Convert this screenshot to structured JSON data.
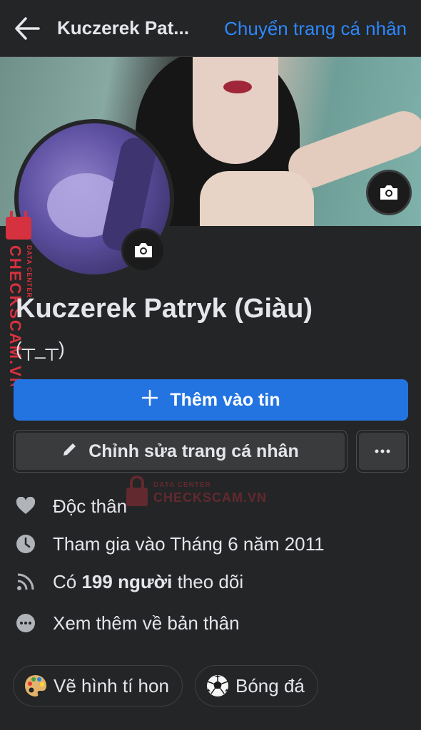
{
  "header": {
    "profile_title": "Kuczerek Pat...",
    "switch_link": "Chuyển trang cá nhân"
  },
  "profile": {
    "name": "Kuczerek Patryk (Giàu)",
    "bio": "(┬_┬)"
  },
  "actions": {
    "add_story": "Thêm vào tin",
    "edit_profile": "Chỉnh sửa trang cá nhân"
  },
  "details": {
    "relationship": "Độc thân",
    "joined": "Tham gia vào Tháng 6 năm 2011",
    "followers_prefix": "Có ",
    "followers_count": "199 người",
    "followers_suffix": " theo dõi",
    "see_more": "Xem thêm về bản thân"
  },
  "hobbies": [
    {
      "label": "Vẽ hình tí hon",
      "icon": "palette-icon"
    },
    {
      "label": "Bóng đá",
      "icon": "soccer-ball-icon"
    }
  ],
  "watermark": {
    "top": "DATA CENTER",
    "bottom": "CHECKSCAM.VN"
  },
  "colors": {
    "background": "#242526",
    "accent": "#2374e1",
    "link": "#2d88ff",
    "button_secondary": "#3a3b3c"
  }
}
